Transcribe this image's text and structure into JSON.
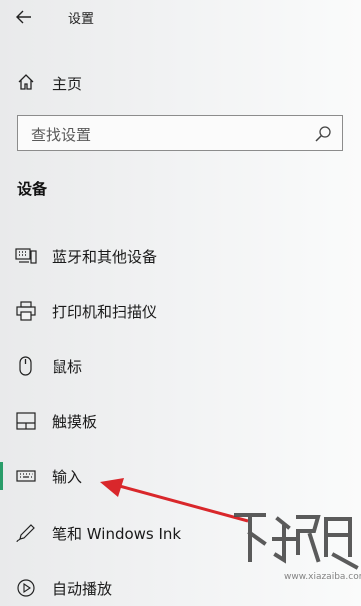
{
  "window": {
    "title": "设置"
  },
  "nav": {
    "home_label": "主页",
    "search_placeholder": "查找设置",
    "section_label": "设备",
    "items": [
      {
        "label": "蓝牙和其他设备",
        "icon": "bluetooth-devices-icon"
      },
      {
        "label": "打印机和扫描仪",
        "icon": "printer-icon"
      },
      {
        "label": "鼠标",
        "icon": "mouse-icon"
      },
      {
        "label": "触摸板",
        "icon": "touchpad-icon"
      },
      {
        "label": "输入",
        "icon": "keyboard-icon",
        "selected": true
      },
      {
        "label": "笔和 Windows Ink",
        "icon": "pen-icon"
      },
      {
        "label": "自动播放",
        "icon": "autoplay-icon"
      }
    ]
  },
  "colors": {
    "accent": "#2a9d6a",
    "arrow": "#d9272b"
  },
  "watermark_text": "下载吧"
}
